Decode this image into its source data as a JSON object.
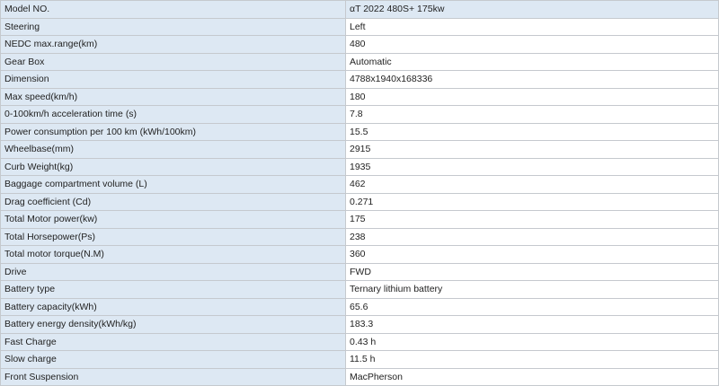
{
  "specs": {
    "rows": [
      {
        "label": "Model NO.",
        "value": "αT 2022 480S+ 175kw"
      },
      {
        "label": "Steering",
        "value": "Left"
      },
      {
        "label": "NEDC max.range(km)",
        "value": "480"
      },
      {
        "label": "Gear Box",
        "value": "Automatic"
      },
      {
        "label": "Dimension",
        "value": "4788x1940x168336"
      },
      {
        "label": "Max speed(km/h)",
        "value": "180"
      },
      {
        "label": "0-100km/h acceleration time (s)",
        "value": "7.8"
      },
      {
        "label": "Power consumption per 100 km (kWh/100km)",
        "value": "15.5"
      },
      {
        "label": "Wheelbase(mm)",
        "value": "2915"
      },
      {
        "label": "Curb Weight(kg)",
        "value": "1935"
      },
      {
        "label": "Baggage compartment volume (L)",
        "value": "462"
      },
      {
        "label": "Drag coefficient (Cd)",
        "value": "0.271"
      },
      {
        "label": "Total Motor power(kw)",
        "value": "175"
      },
      {
        "label": "Total Horsepower(Ps)",
        "value": "238"
      },
      {
        "label": "Total motor torque(N.M)",
        "value": "360"
      },
      {
        "label": "Drive",
        "value": "FWD"
      },
      {
        "label": "Battery type",
        "value": "Ternary lithium battery"
      },
      {
        "label": "Battery capacity(kWh)",
        "value": "65.6"
      },
      {
        "label": "Battery energy density(kWh/kg)",
        "value": "183.3"
      },
      {
        "label": "Fast Charge",
        "value": "0.43 h"
      },
      {
        "label": "Slow charge",
        "value": "11.5 h"
      },
      {
        "label": "Front Suspension",
        "value": "MacPherson"
      }
    ]
  },
  "colors": {
    "label_background": "#dde8f3",
    "value_background": "#ffffff",
    "border": "#c5c9ce",
    "text": "#222222"
  }
}
